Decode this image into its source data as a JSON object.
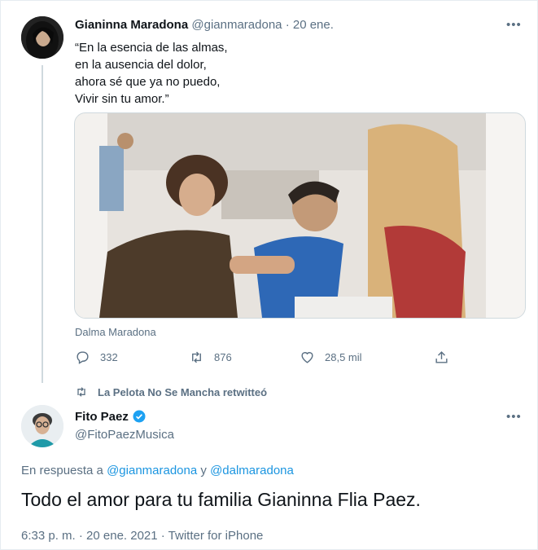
{
  "tweet1": {
    "display_name": "Gianinna Maradona",
    "handle": "@gianmaradona",
    "separator": "·",
    "date": "20 ene.",
    "lines": [
      "“En la esencia de las almas,",
      "en la ausencia del dolor,",
      "ahora sé que ya no puedo,",
      "Vivir sin tu amor.”"
    ],
    "media_caption": "Dalma Maradona",
    "replies": "332",
    "retweets": "876",
    "likes": "28,5 mil"
  },
  "retweet_label": "La Pelota No Se Mancha retwitteó",
  "tweet2": {
    "display_name": "Fito Paez",
    "handle": "@FitoPaezMusica",
    "reply_prefix": "En respuesta a",
    "reply_user1": "@gianmaradona",
    "reply_conj": "y",
    "reply_user2": "@dalmaradona",
    "text": "Todo el amor para tu familia Gianinna Flia Paez.",
    "timestamp": "6:33 p. m. · 20 ene. 2021 · Twitter for iPhone"
  },
  "icons": {
    "more": "more-icon",
    "reply": "reply-icon",
    "retweet": "retweet-icon",
    "like": "heart-icon",
    "share": "share-icon",
    "verified": "verified-badge-icon"
  },
  "colors": {
    "accent": "#1b95e0",
    "muted": "#5b7083",
    "text": "#0f1419"
  }
}
